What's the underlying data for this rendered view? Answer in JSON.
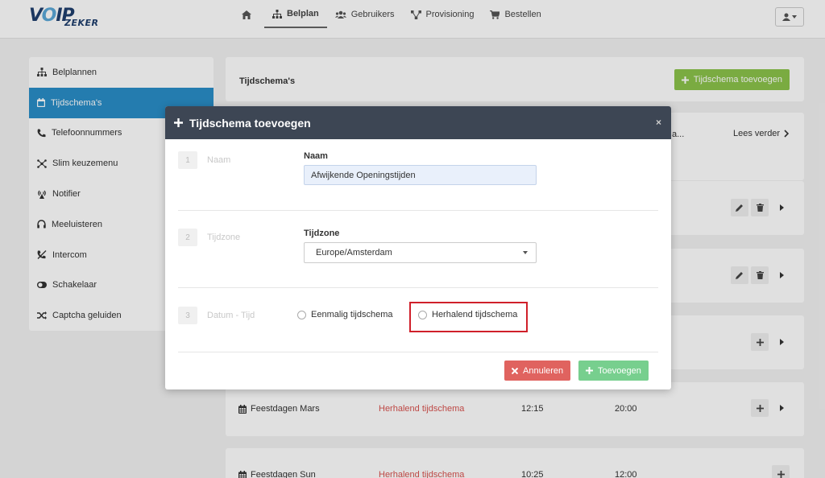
{
  "nav": {
    "logo_main": "VOIP",
    "logo_sub": "ZEKER",
    "items": [
      {
        "label": "",
        "icon": "home-icon"
      },
      {
        "label": "Belplan",
        "icon": "sitemap-icon",
        "active": true
      },
      {
        "label": "Gebruikers",
        "icon": "users-icon"
      },
      {
        "label": "Provisioning",
        "icon": "network-icon"
      },
      {
        "label": "Bestellen",
        "icon": "cart-icon"
      }
    ],
    "user_icon": "user-icon"
  },
  "sidebar": {
    "items": [
      {
        "label": "Belplannen",
        "icon": "sitemap-icon"
      },
      {
        "label": "Tijdschema's",
        "icon": "calendar-icon",
        "active": true
      },
      {
        "label": "Telefoonnummers",
        "icon": "phone-icon"
      },
      {
        "label": "Slim keuzemenu",
        "icon": "menu-tree-icon"
      },
      {
        "label": "Notifier",
        "icon": "broadcast-icon"
      },
      {
        "label": "Meeluisteren",
        "icon": "headphones-icon"
      },
      {
        "label": "Intercom",
        "icon": "intercom-icon"
      },
      {
        "label": "Schakelaar",
        "icon": "toggle-icon"
      },
      {
        "label": "Captcha geluiden",
        "icon": "shuffle-icon"
      }
    ]
  },
  "page": {
    "title": "Tijdschema's",
    "add_button": "Tijdschema toevoegen",
    "truncated": "a...",
    "read_more": "Lees verder",
    "rows": [
      {
        "name": "Feestdagen Mars",
        "type": "Herhalend tijdschema",
        "start": "12:15",
        "end": "20:00"
      },
      {
        "name": "Feestdagen Sun",
        "type": "Herhalend tijdschema",
        "start": "10:25",
        "end": "12:00"
      }
    ]
  },
  "modal": {
    "title": "Tijdschema toevoegen",
    "close": "×",
    "steps": [
      {
        "num": "1",
        "label": "Naam"
      },
      {
        "num": "2",
        "label": "Tijdzone"
      },
      {
        "num": "3",
        "label": "Datum - Tijd"
      }
    ],
    "name_label": "Naam",
    "name_value": "Afwijkende Openingstijden",
    "tz_label": "Tijdzone",
    "tz_value": "Europe/Amsterdam",
    "radio_once": "Eenmalig tijdschema",
    "radio_repeat": "Herhalend tijdschema",
    "cancel": "Annuleren",
    "submit": "Toevoegen",
    "highlight_color": "#d0202a"
  }
}
